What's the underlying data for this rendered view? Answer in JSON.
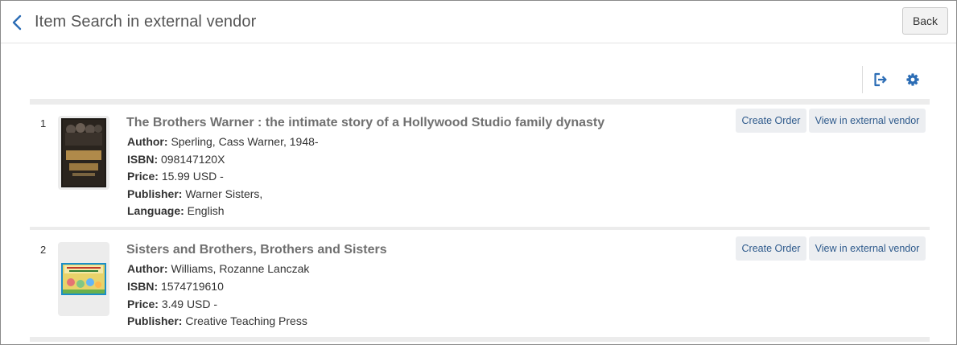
{
  "header": {
    "title": "Item Search in external vendor",
    "back_label": "Back"
  },
  "toolbar": {
    "export_icon": "export-icon",
    "settings_icon": "gear-icon",
    "accent_color": "#2c6db5"
  },
  "results": [
    {
      "index": "1",
      "title": "The Brothers Warner : the intimate story of a Hollywood Studio family dynasty",
      "author_label": "Author:",
      "author": "Sperling, Cass Warner, 1948-",
      "isbn_label": "ISBN:",
      "isbn": "098147120X",
      "price_label": "Price:",
      "price": "15.99 USD -",
      "publisher_label": "Publisher:",
      "publisher": "Warner Sisters,",
      "language_label": "Language:",
      "language": "English",
      "create_order_label": "Create Order",
      "view_vendor_label": "View in external vendor"
    },
    {
      "index": "2",
      "title": "Sisters and Brothers, Brothers and Sisters",
      "author_label": "Author:",
      "author": "Williams, Rozanne Lanczak",
      "isbn_label": "ISBN:",
      "isbn": "1574719610",
      "price_label": "Price:",
      "price": "3.49 USD -",
      "publisher_label": "Publisher:",
      "publisher": "Creative Teaching Press",
      "create_order_label": "Create Order",
      "view_vendor_label": "View in external vendor"
    }
  ]
}
